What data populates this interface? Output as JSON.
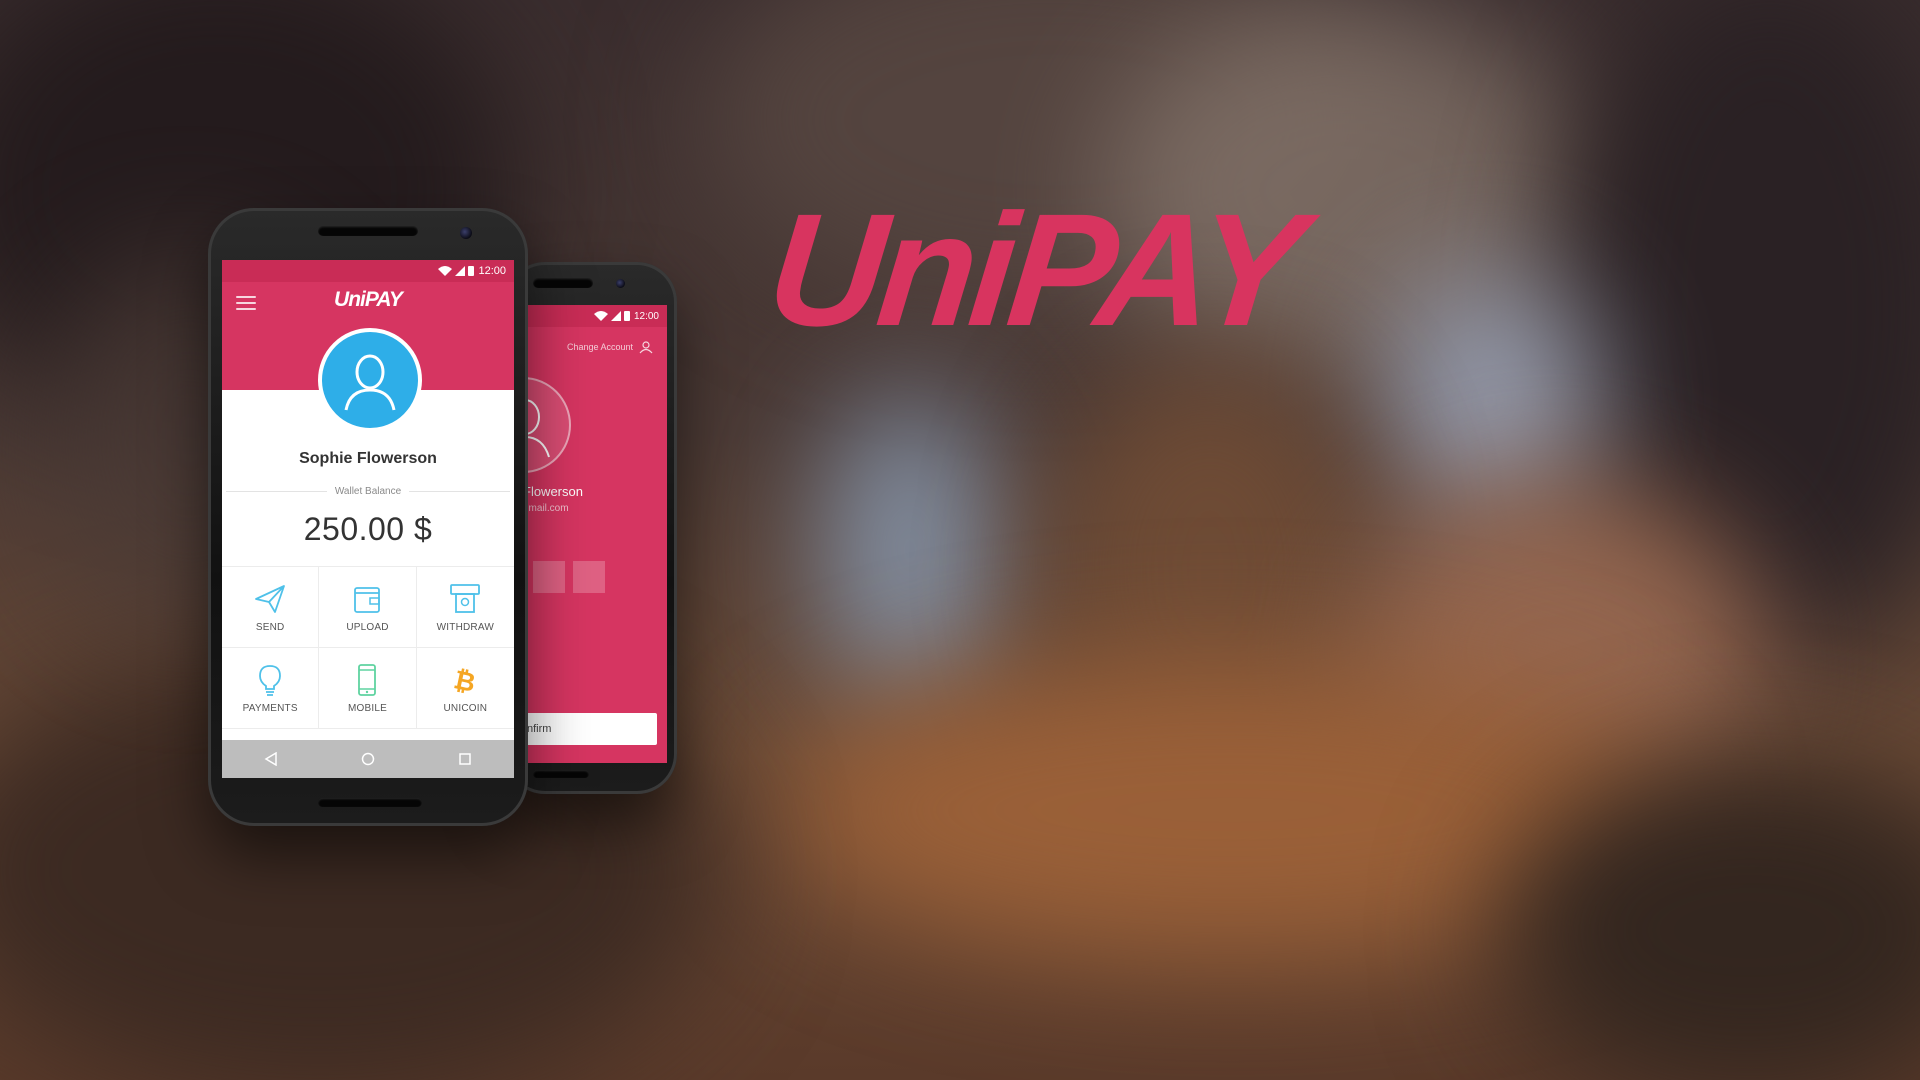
{
  "logo": {
    "text": "UniPAY",
    "color": "#d8345f"
  },
  "front_phone": {
    "status_time": "12:00",
    "app_title": "UniPAY",
    "user_name": "Sophie Flowerson",
    "balance_label": "Wallet Balance",
    "balance_value": "250.00 $",
    "actions": [
      {
        "label": "SEND",
        "icon": "paper-plane-icon"
      },
      {
        "label": "UPLOAD",
        "icon": "wallet-icon"
      },
      {
        "label": "WITHDRAW",
        "icon": "atm-icon"
      },
      {
        "label": "PAYMENTS",
        "icon": "lightbulb-icon"
      },
      {
        "label": "MOBILE",
        "icon": "mobile-phone-icon"
      },
      {
        "label": "UNICOIN",
        "icon": "bitcoin-icon"
      }
    ],
    "nav": [
      "back-icon",
      "home-icon",
      "recents-icon"
    ]
  },
  "back_phone": {
    "status_time": "12:00",
    "change_account": "Change Account",
    "user_name_partial": "Flowerson",
    "email_partial": "gmail.com",
    "confirm_partial": "nfirm"
  },
  "colors": {
    "brand_pink": "#d63561",
    "status_pink": "#c92c56",
    "avatar_blue": "#2eaee8",
    "icon_blue": "#4fc1e9",
    "icon_green": "#5fd3a0",
    "icon_orange": "#f5a623"
  }
}
